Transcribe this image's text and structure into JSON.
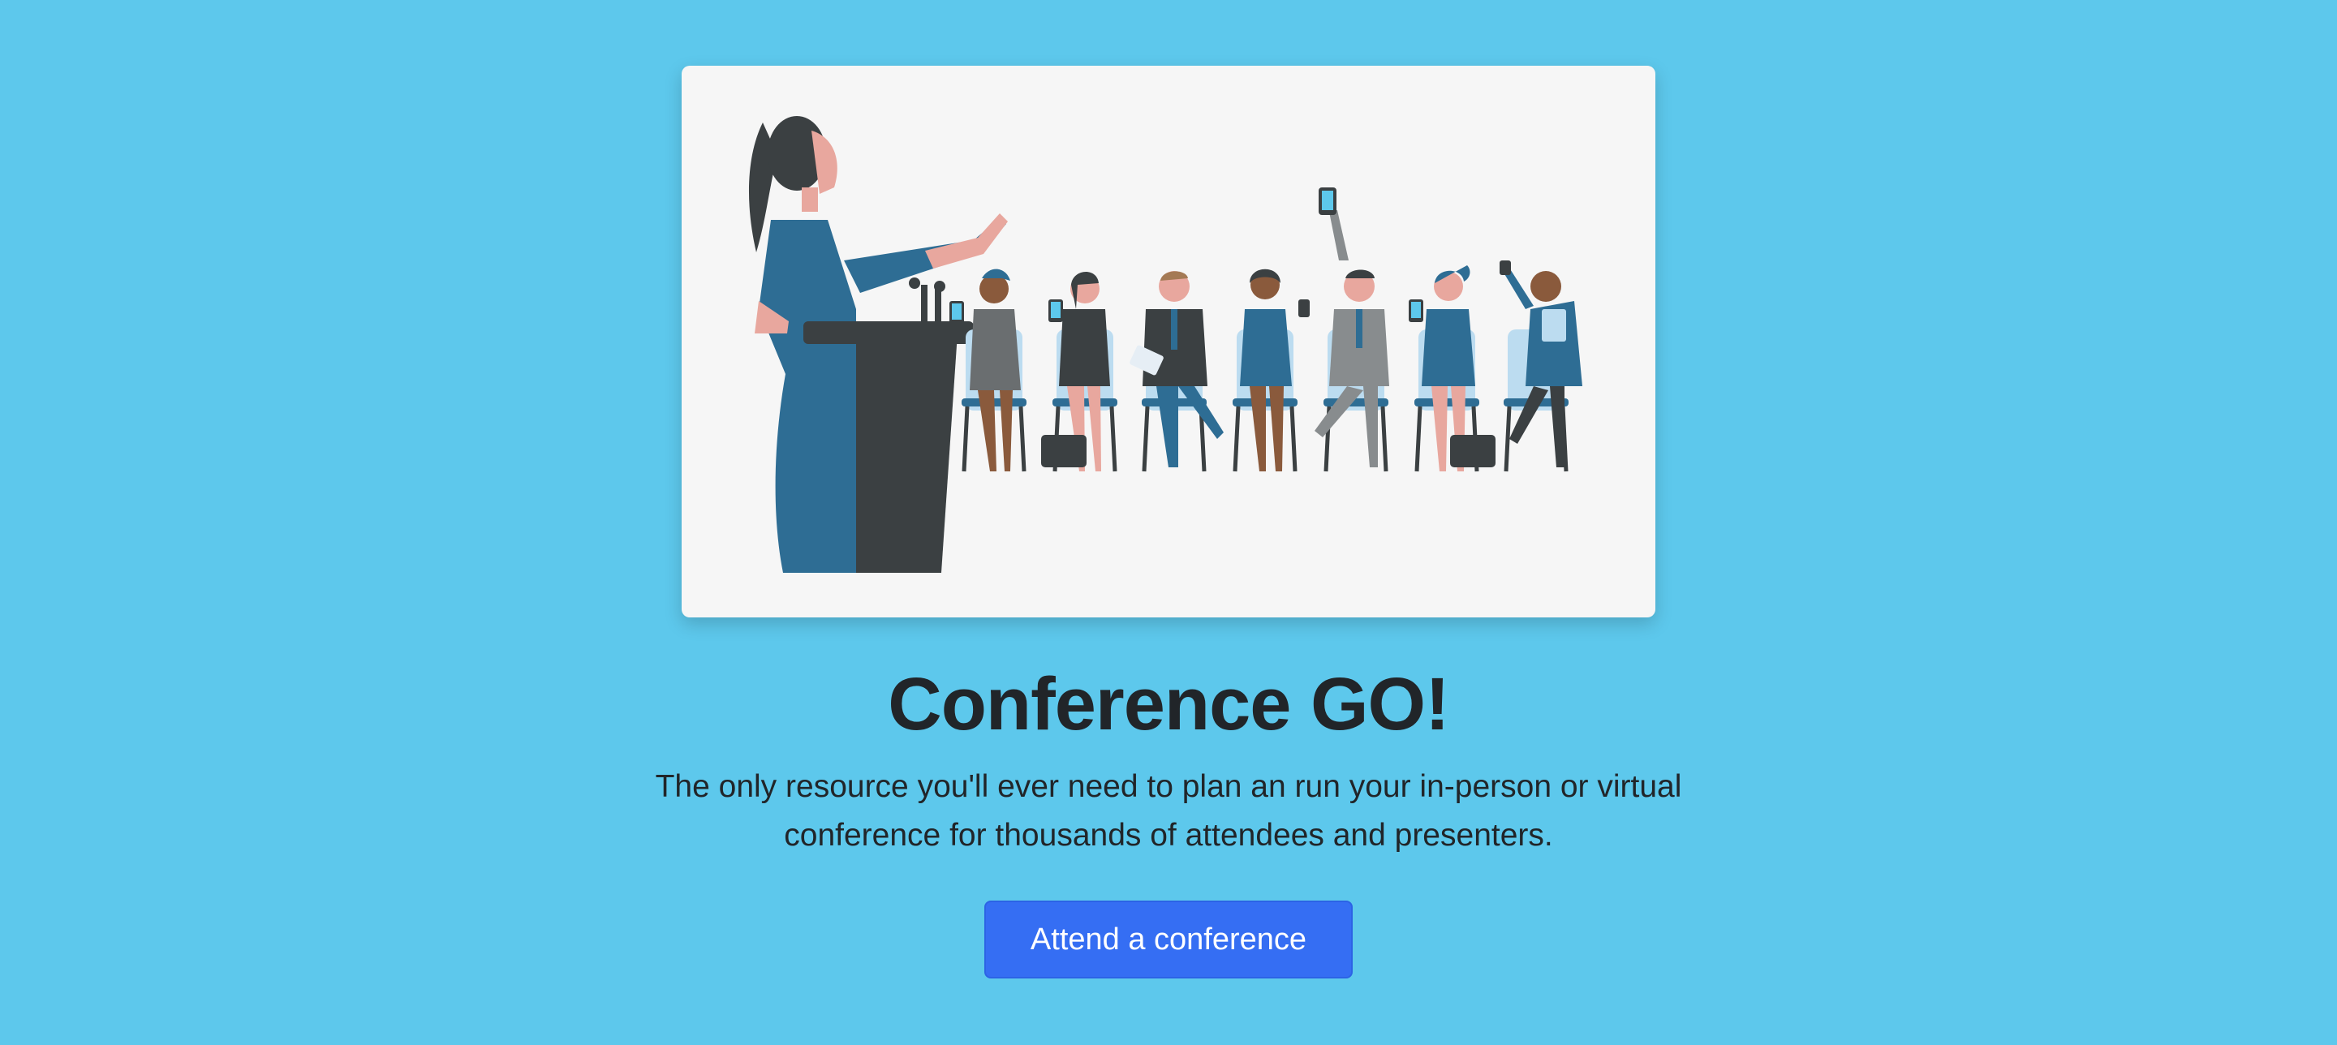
{
  "hero": {
    "title": "Conference GO!",
    "lead": "The only resource you'll ever need to plan an run your in-person or virtual conference for thousands of attendees and presenters.",
    "cta_label": "Attend a conference"
  },
  "colors": {
    "background": "#5dc8ec",
    "card_background": "#f6f6f6",
    "button_background": "#356ef3",
    "text": "#212529"
  },
  "illustration": {
    "subject": "speaker-at-podium-with-seated-audience"
  }
}
